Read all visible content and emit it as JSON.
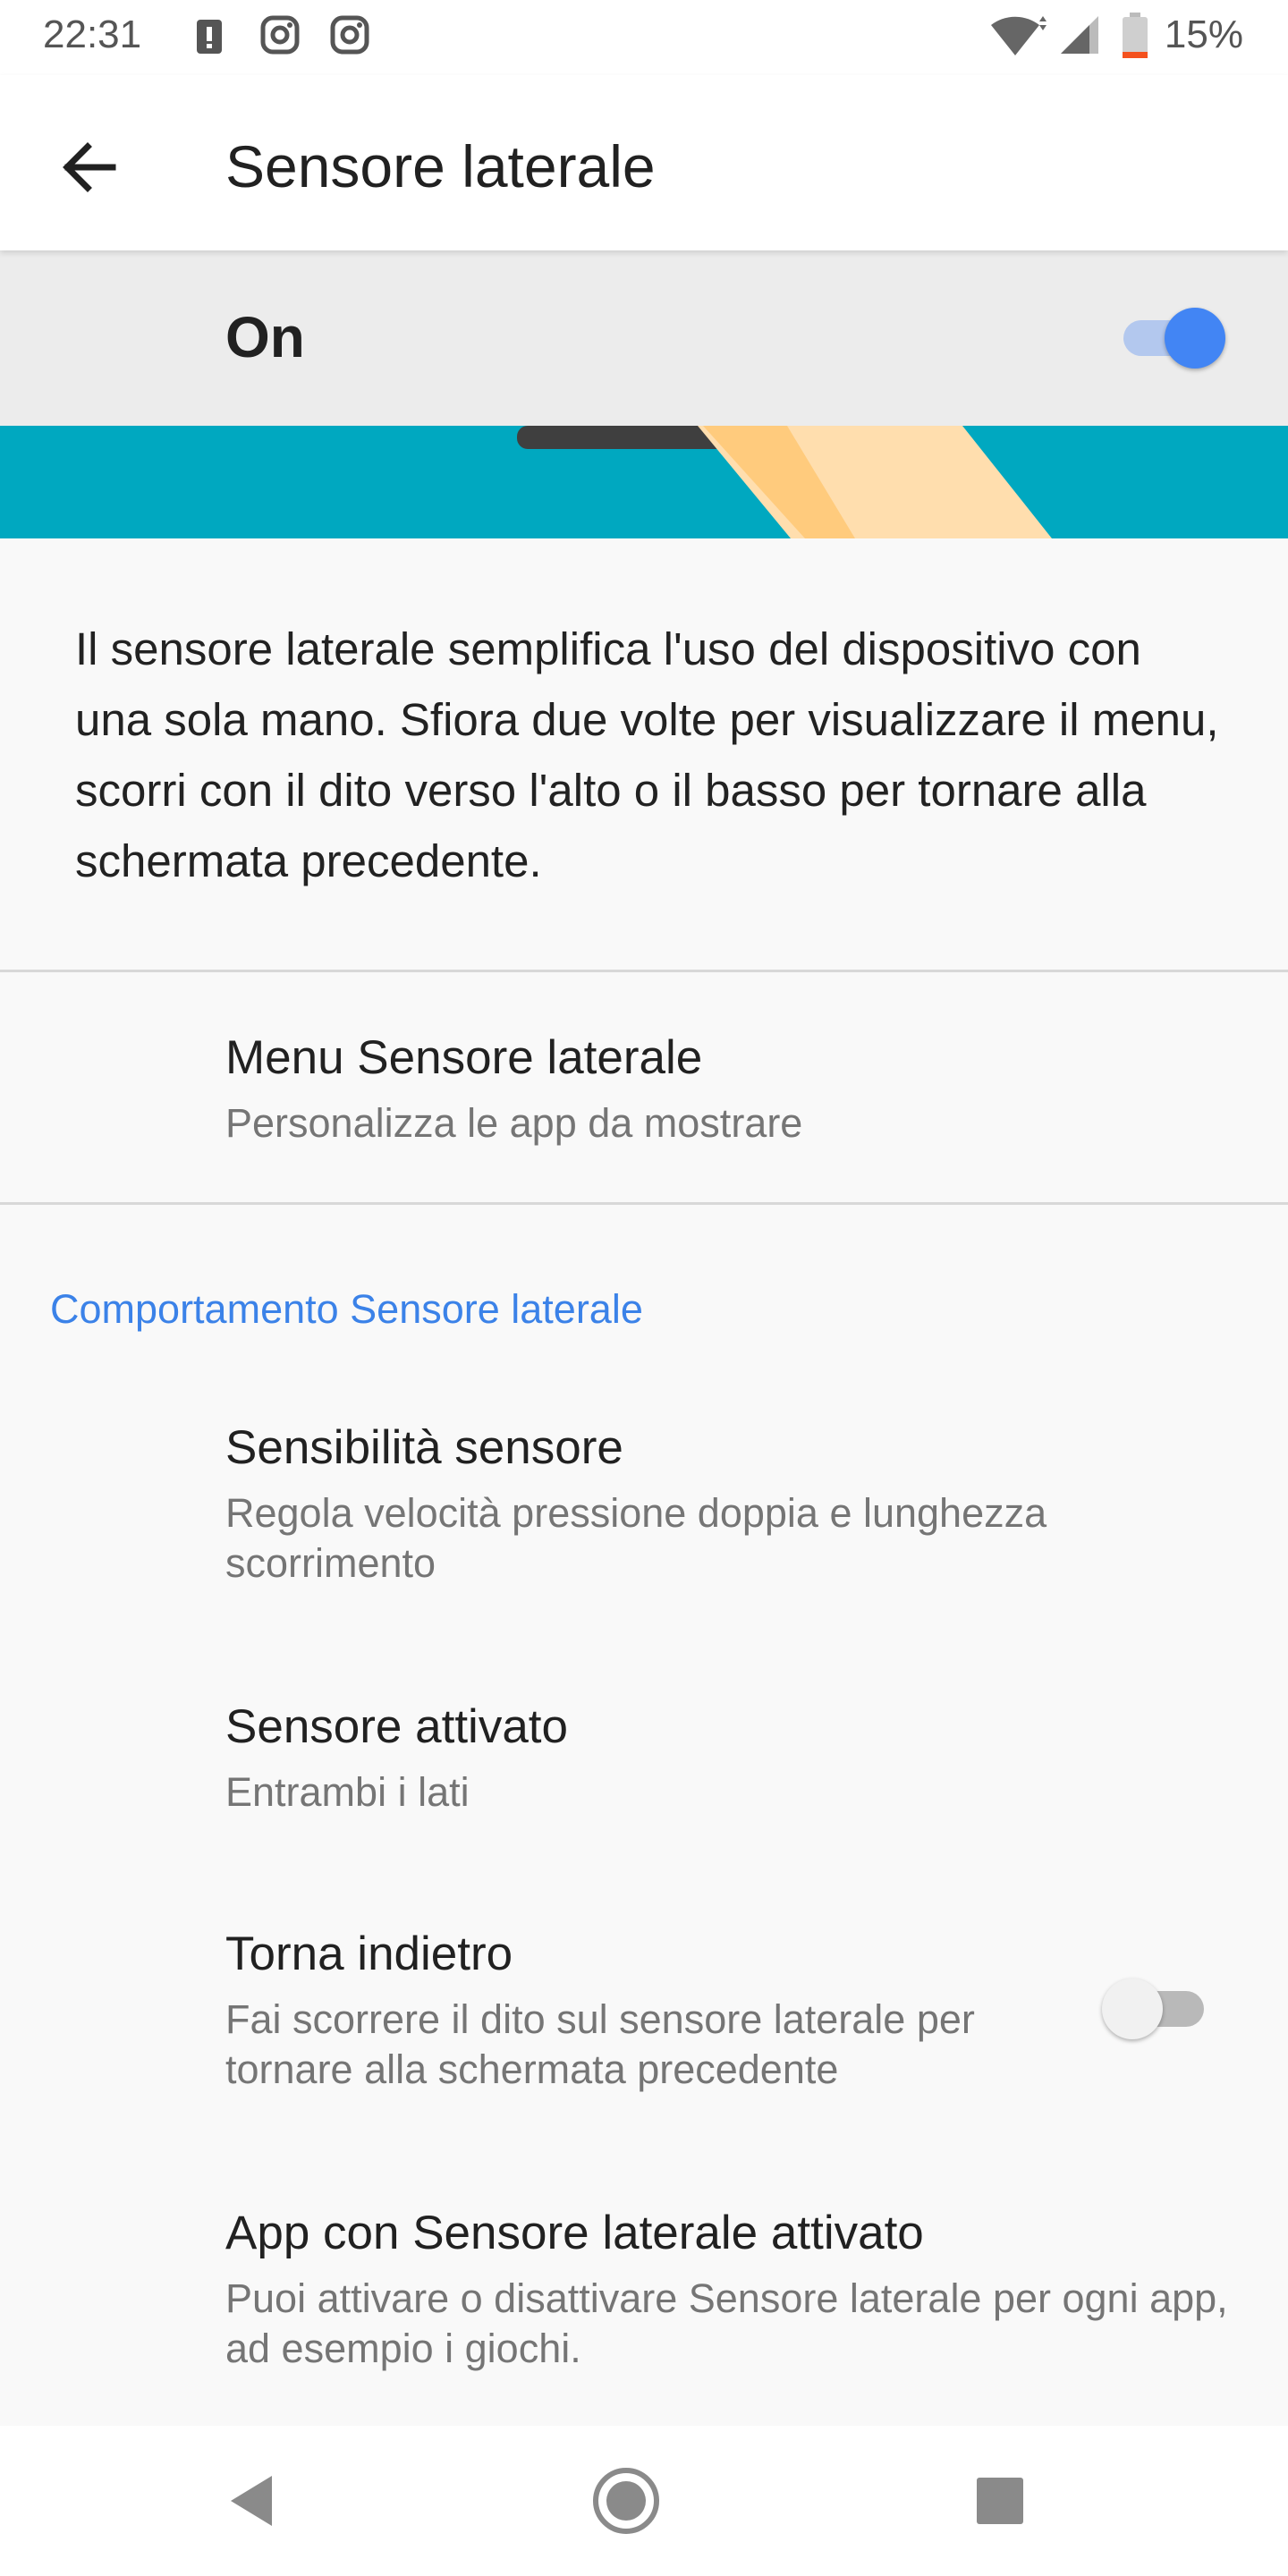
{
  "status_bar": {
    "time": "22:31",
    "notification_icons": [
      "alert-icon",
      "instagram-icon",
      "instagram-icon"
    ],
    "battery_percent": "15%",
    "battery_level": 0.15,
    "battery_color": "#f4511e"
  },
  "app_bar": {
    "title": "Sensore laterale"
  },
  "master_switch": {
    "label": "On",
    "enabled": true,
    "accent_color": "#4285f4"
  },
  "description": "Il sensore laterale semplifica l'uso del dispositivo con una sola mano. Sfiora due volte per visualizzare il menu, scorri con il dito verso l'alto o il basso per tornare alla schermata precedente.",
  "menu_item": {
    "title": "Menu Sensore laterale",
    "subtitle": "Personalizza le app da mostrare"
  },
  "section": {
    "header": "Comportamento Sensore laterale",
    "header_color": "#3b82e8",
    "items": [
      {
        "title": "Sensibilità sensore",
        "subtitle": "Regola velocità pressione doppia e lunghezza scorrimento"
      },
      {
        "title": "Sensore attivato",
        "subtitle": "Entrambi i lati"
      },
      {
        "title": "Torna indietro",
        "subtitle": "Fai scorrere il dito sul sensore laterale per tornare alla schermata precedente",
        "toggle": false
      },
      {
        "title": "App con Sensore laterale attivato",
        "subtitle": "Puoi attivare o disattivare Sensore laterale per ogni app, ad esempio i giochi."
      }
    ]
  },
  "nav_bar": {
    "icons": [
      "back-triangle-icon",
      "home-circle-icon",
      "recents-square-icon"
    ]
  }
}
